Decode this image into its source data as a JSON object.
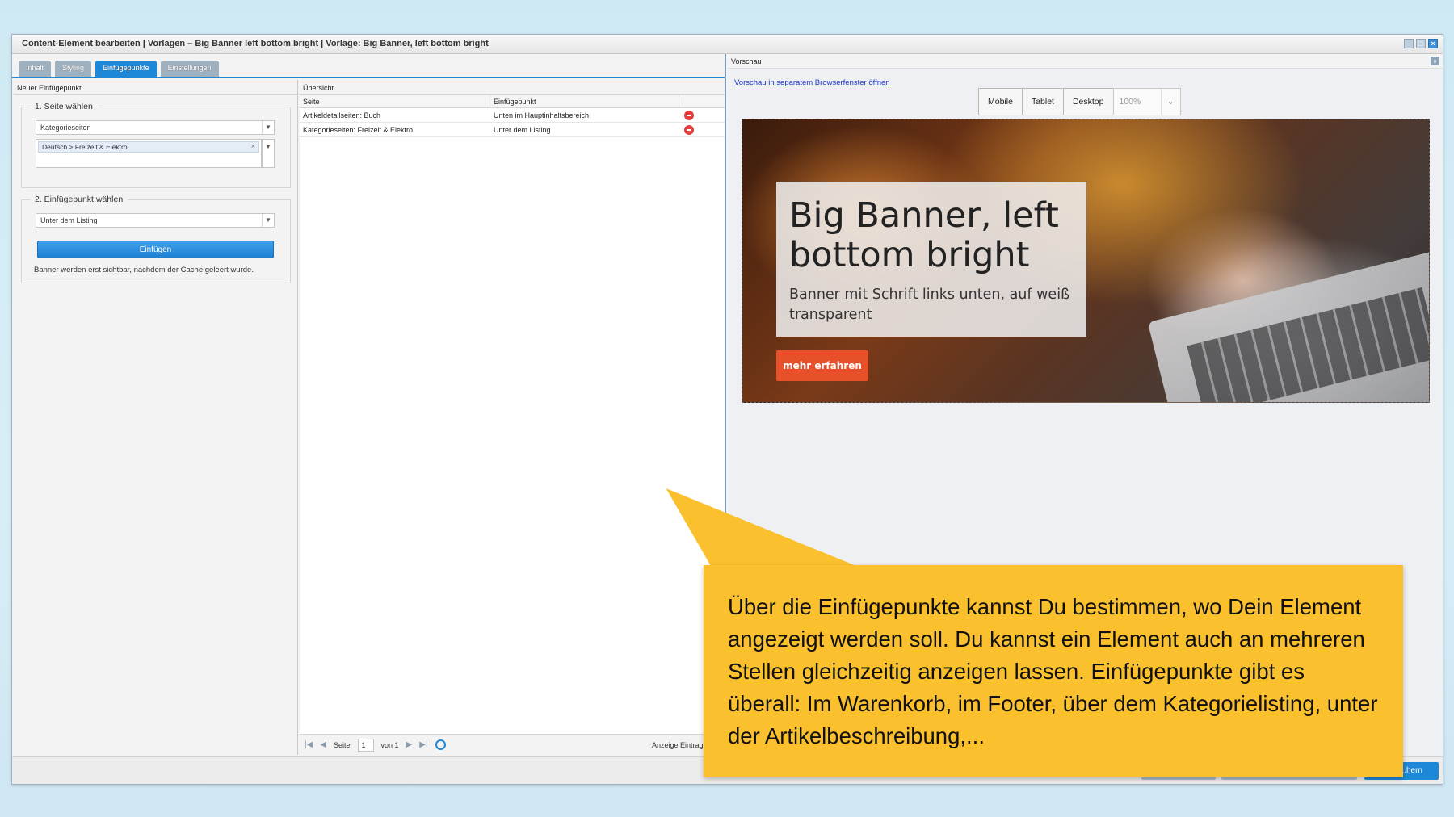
{
  "window": {
    "title": "Content-Element bearbeiten | Vorlagen – Big Banner left bottom bright | Vorlage: Big Banner, left bottom bright"
  },
  "tabs": [
    {
      "label": "Inhalt",
      "active": false
    },
    {
      "label": "Styling",
      "active": false
    },
    {
      "label": "Einfügepunkte",
      "active": true
    },
    {
      "label": "Einstellungen",
      "active": false
    }
  ],
  "left_panel": {
    "header": "Neuer Einfügepunkt",
    "section1": {
      "legend": "1. Seite wählen",
      "page_type": "Kategorieseiten",
      "category_tag": "Deutsch > Freizeit & Elektro"
    },
    "section2": {
      "legend": "2. Einfügepunkt wählen",
      "insert_point": "Unter dem Listing",
      "insert_button": "Einfügen",
      "hint": "Banner werden erst sichtbar, nachdem der Cache geleert wurde."
    }
  },
  "overview": {
    "header": "Übersicht",
    "columns": [
      "Seite",
      "Einfügepunkt"
    ],
    "rows": [
      {
        "page": "Artikeldetailseiten: Buch",
        "point": "Unten im Hauptinhaltsbereich"
      },
      {
        "page": "Kategorieseiten: Freizeit & Elektro",
        "point": "Unter dem Listing"
      }
    ],
    "pager": {
      "page_label": "Seite",
      "page_value": "1",
      "of_label": "von 1",
      "count": "Anzeige Eintrag 1 - 2"
    }
  },
  "preview": {
    "header": "Vorschau",
    "open_link": "Vorschau in separatem Browserfenster öffnen",
    "devices": [
      "Mobile",
      "Tablet",
      "Desktop"
    ],
    "zoom": "100%",
    "banner": {
      "title": "Big Banner, left bottom bright",
      "subtitle": "Banner mit Schrift links unten, auf weiß transparent",
      "cta": "mehr erfahren"
    }
  },
  "footer": {
    "primary_button": "...hern"
  },
  "callout": {
    "text": "Über die Einfügepunkte kannst Du bestimmen, wo Dein Element angezeigt werden soll. Du kannst ein Element auch an mehreren Stellen gleichzeitig anzeigen lassen. Einfügepunkte gibt es überall: Im Warenkorb, im Footer, über dem Kategorielisting, unter der Artikelbeschreibung,..."
  },
  "colors": {
    "accent": "#1d88d8",
    "callout": "#fbc02d",
    "cta": "#e8502a",
    "delete": "#e53d3d"
  }
}
